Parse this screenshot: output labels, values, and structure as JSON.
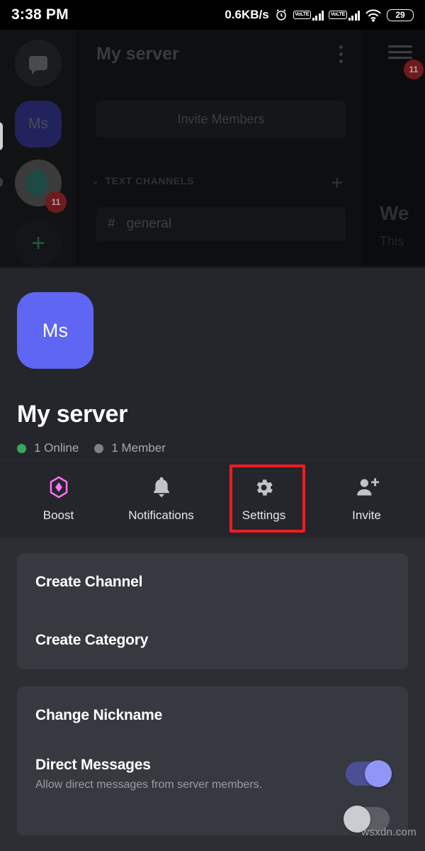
{
  "status_bar": {
    "time": "3:38 PM",
    "network_speed": "0.6KB/s",
    "alarm_icon": "alarm-clock-icon",
    "sim1_label": "VoLTE",
    "sim2_label": "VoLTE",
    "wifi_icon": "wifi-icon",
    "battery_percent": "29"
  },
  "backdrop": {
    "server_title": "My server",
    "overflow_icon": "three-dots-vertical-icon",
    "invite_members_label": "Invite Members",
    "category_label": "TEXT CHANNELS",
    "category_chevron": "⌄",
    "add_channel_icon": "+",
    "channel_hash": "#",
    "channel_name": "general",
    "guild_ms_initials": "Ms",
    "guild_badge_count": "11",
    "add_server_icon": "+",
    "menu_badge_count": "11",
    "welcome_partial": "We",
    "description_partial": "This",
    "home_icon": "direct-messages-icon",
    "hamburger_icon": "hamburger-menu-icon"
  },
  "sheet": {
    "avatar_initials": "Ms",
    "server_name": "My server",
    "presence": [
      {
        "label": "1 Online",
        "dot_color": "#3ba55d"
      },
      {
        "label": "1 Member",
        "dot_color": "#7c8089"
      }
    ],
    "actions": [
      {
        "label": "Boost",
        "icon": "boost-gem-icon"
      },
      {
        "label": "Notifications",
        "icon": "bell-icon"
      },
      {
        "label": "Settings",
        "icon": "gear-icon",
        "highlighted": true
      },
      {
        "label": "Invite",
        "icon": "person-add-icon"
      }
    ],
    "highlight_color": "#ed1c24",
    "cards": [
      {
        "rows": [
          {
            "title": "Create Channel"
          },
          {
            "title": "Create Category"
          }
        ]
      },
      {
        "rows": [
          {
            "title": "Change Nickname"
          },
          {
            "title": "Direct Messages",
            "subtitle": "Allow direct messages from server members.",
            "toggle": "on"
          },
          {
            "title": "",
            "toggle": "off"
          }
        ]
      }
    ]
  },
  "watermark": "wsxdn.com",
  "colors": {
    "accent_blurple": "#5f66f3",
    "toggle_on_track": "#4b4f93",
    "toggle_on_knob": "#9096f5",
    "online_green": "#3ba55d",
    "boost_pink": "#ff73fa",
    "sheet_bg": "#2c2e33",
    "card_bg": "#36393f",
    "header_bg": "#24262b"
  }
}
